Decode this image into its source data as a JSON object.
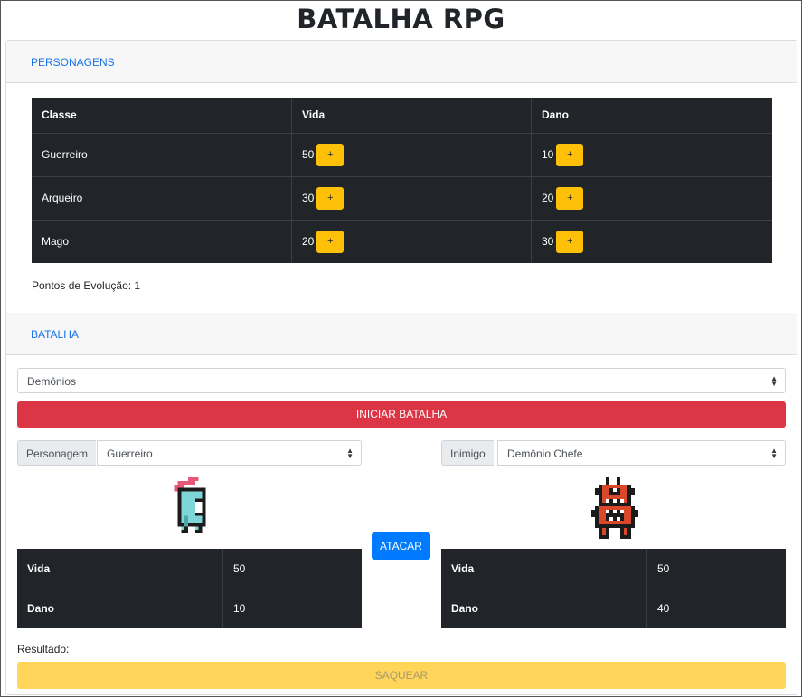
{
  "title": "BATALHA RPG",
  "personagens": {
    "header": "PERSONAGENS",
    "columns": [
      "Classe",
      "Vida",
      "Dano"
    ],
    "rows": [
      {
        "classe": "Guerreiro",
        "vida": "50",
        "dano": "10"
      },
      {
        "classe": "Arqueiro",
        "vida": "30",
        "dano": "20"
      },
      {
        "classe": "Mago",
        "vida": "20",
        "dano": "30"
      }
    ],
    "plus_label": "+",
    "pontos_label": "Pontos de Evolução: 1"
  },
  "batalha": {
    "header": "BATALHA",
    "mode_value": "Demônios",
    "start_label": "INICIAR BATALHA",
    "attack_label": "ATACAR",
    "player": {
      "prefix": "Personagem",
      "value": "Guerreiro",
      "stats": [
        {
          "label": "Vida",
          "value": "50"
        },
        {
          "label": "Dano",
          "value": "10"
        }
      ]
    },
    "enemy": {
      "prefix": "Inimigo",
      "value": "Demônio Chefe",
      "stats": [
        {
          "label": "Vida",
          "value": "50"
        },
        {
          "label": "Dano",
          "value": "40"
        }
      ]
    },
    "result_label": "Resultado:",
    "loot_label": "SAQUEAR"
  },
  "colors": {
    "red": "#dc3545",
    "blue": "#007bff",
    "yellow": "#ffc107",
    "dark": "#212529",
    "link": "#1a73e8"
  },
  "icons": {
    "player_sprite": "knight-sprite-icon",
    "enemy_sprite": "demon-sprite-icon",
    "select_arrow": "up-down-chevron-icon"
  }
}
